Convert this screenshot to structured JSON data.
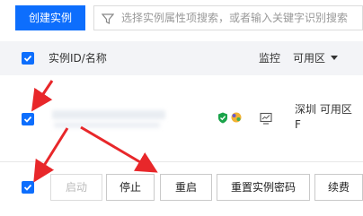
{
  "toolbar": {
    "create_label": "创建实例",
    "search_placeholder": "选择实例属性项搜索，或者输入关键字识别搜索"
  },
  "table": {
    "headers": {
      "id_name": "实例ID/名称",
      "monitor": "监控",
      "zone": "可用区"
    },
    "row": {
      "checked": true,
      "zone": "深圳 可用区F"
    }
  },
  "actions": {
    "start": "启动",
    "stop": "停止",
    "restart": "重启",
    "reset_password": "重置实例密码",
    "renew": "续费"
  },
  "colors": {
    "primary": "#0d6efd",
    "annotation": "#e8272a"
  }
}
